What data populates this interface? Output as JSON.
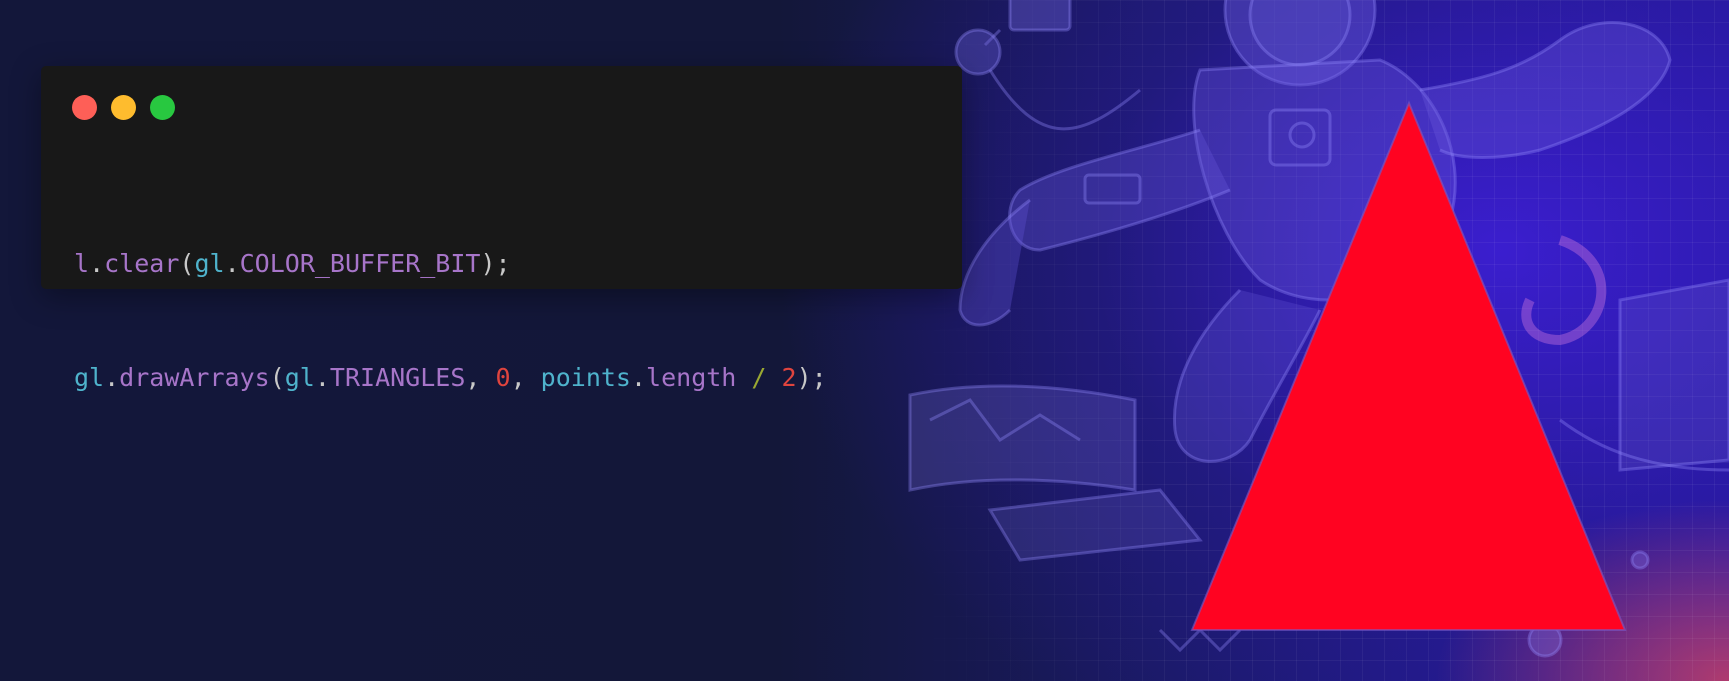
{
  "window": {
    "controls": [
      "close",
      "minimize",
      "maximize"
    ]
  },
  "code": {
    "line1": {
      "obj": "l",
      "dot": ".",
      "method": "clear",
      "open": "(",
      "arg_obj": "gl",
      "arg_dot": ".",
      "arg_const": "COLOR_BUFFER_BIT",
      "close": ");"
    },
    "line2": {
      "obj": "gl",
      "dot": ".",
      "method": "drawArrays",
      "open": "(",
      "arg_obj": "gl",
      "arg_dot": ".",
      "arg_const": "TRIANGLES",
      "comma1": ", ",
      "num0": "0",
      "comma2": ", ",
      "var": "points",
      "var_dot": ".",
      "prop": "length",
      "space1": " ",
      "op": "/",
      "space2": " ",
      "num2": "2",
      "close": ");"
    }
  },
  "colors": {
    "background": "#121633",
    "accent_purple": "#2a1bb0",
    "triangle_fill": "#ff0321",
    "editor_bg": "#181818"
  },
  "icons": [
    "window-close-dot",
    "window-minimize-dot",
    "window-maximize-dot",
    "astronaut-illustration",
    "red-triangle"
  ]
}
